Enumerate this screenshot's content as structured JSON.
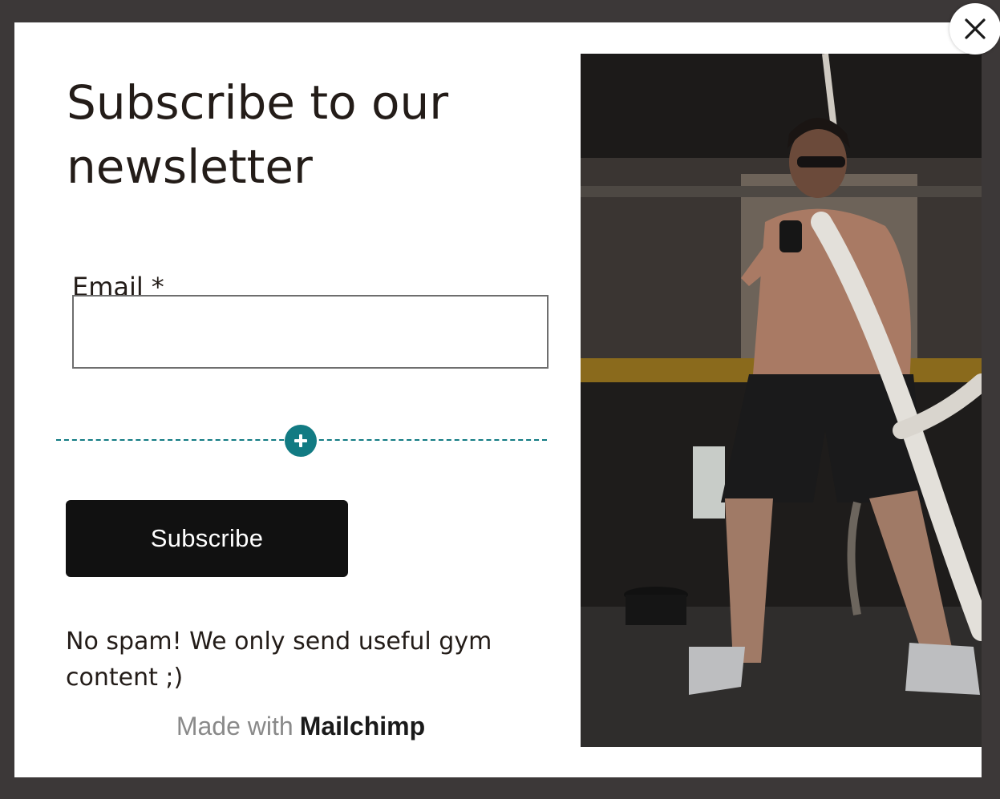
{
  "form": {
    "title": "Subscribe to our newsletter",
    "email_label": "Email",
    "required_marker": "*",
    "email_value": "",
    "email_placeholder": "",
    "submit_label": "Subscribe",
    "disclaimer": "No spam! We only send useful gym content ;)"
  },
  "footer": {
    "made_with": "Made with",
    "brand": "Mailchimp"
  },
  "icons": {
    "close": "close-icon",
    "add_block": "plus-icon"
  },
  "colors": {
    "overlay": "#3c3838",
    "modal_background": "#ffffff",
    "text": "#231c18",
    "accent_teal": "#127b83",
    "button_background": "#111111",
    "button_text": "#ffffff",
    "muted_text": "#8a8a8a"
  },
  "image": {
    "description_icon": "gym-battle-ropes-photo"
  }
}
